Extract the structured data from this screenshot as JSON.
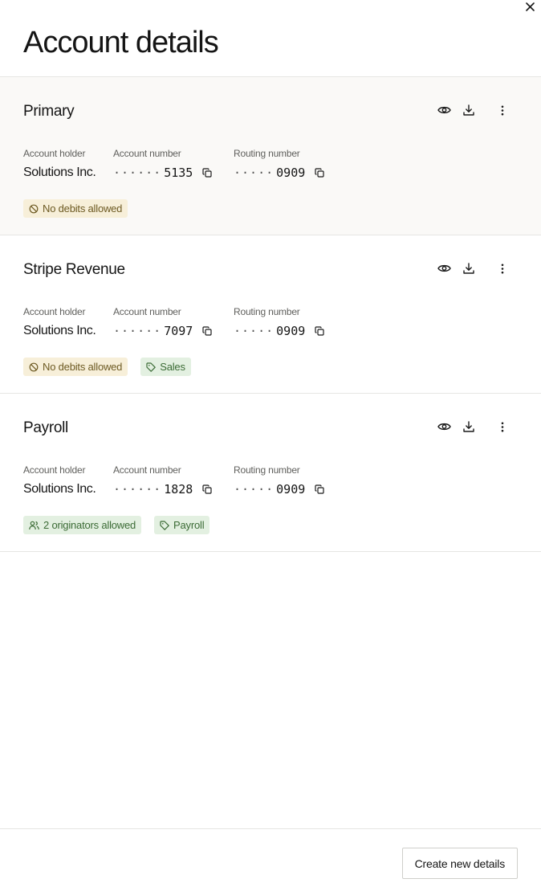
{
  "header": {
    "title": "Account details",
    "close_icon": "close-icon"
  },
  "labels": {
    "holder": "Account holder",
    "account_number": "Account number",
    "routing_number": "Routing number"
  },
  "accounts": [
    {
      "name": "Primary",
      "holder": "Solutions Inc.",
      "account_dots": "······",
      "account_last4": "5135",
      "routing_dots": "·····",
      "routing_last4": "0909",
      "badges": [
        {
          "label": "No debits allowed",
          "icon": "no-entry-icon",
          "tone": "warn"
        }
      ]
    },
    {
      "name": "Stripe Revenue",
      "holder": "Solutions Inc.",
      "account_dots": "······",
      "account_last4": "7097",
      "routing_dots": "·····",
      "routing_last4": "0909",
      "badges": [
        {
          "label": "No debits allowed",
          "icon": "no-entry-icon",
          "tone": "warn"
        },
        {
          "label": "Sales",
          "icon": "tag-icon",
          "tone": "ok"
        }
      ]
    },
    {
      "name": "Payroll",
      "holder": "Solutions Inc.",
      "account_dots": "······",
      "account_last4": "1828",
      "routing_dots": "·····",
      "routing_last4": "0909",
      "badges": [
        {
          "label": "2 originators allowed",
          "icon": "users-icon",
          "tone": "ok"
        },
        {
          "label": "Payroll",
          "icon": "tag-icon",
          "tone": "ok"
        }
      ]
    }
  ],
  "footer": {
    "create_label": "Create new details"
  },
  "colors": {
    "warn_bg": "#f7efd9",
    "warn_text": "#6d5a23",
    "ok_bg": "#e3f0e1",
    "ok_text": "#3b6b35",
    "selected_row_bg": "#faf9f7"
  }
}
